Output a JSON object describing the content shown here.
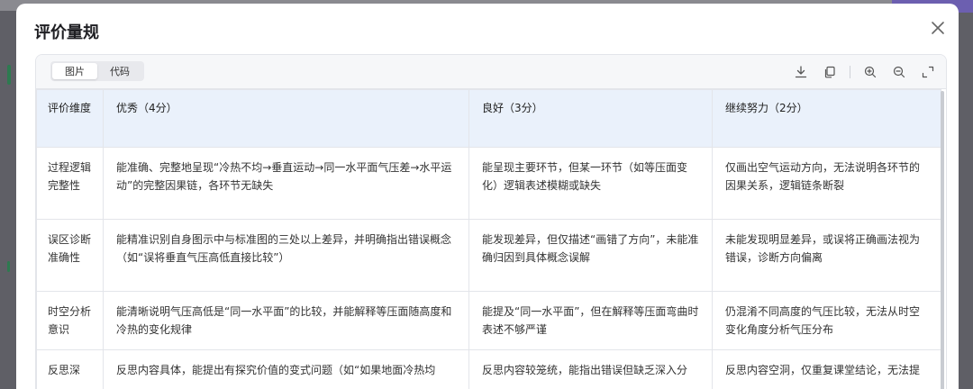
{
  "modal": {
    "title": "评价量规",
    "tabs": [
      {
        "label": "图片",
        "active": true
      },
      {
        "label": "代码",
        "active": false
      }
    ],
    "toolbar_icons": [
      "download-icon",
      "copy-icon",
      "zoom-in-icon",
      "zoom-out-icon",
      "fullscreen-icon"
    ]
  },
  "rubric": {
    "headers": [
      "评价维度",
      "优秀（4分）",
      "良好（3分）",
      "继续努力（2分）"
    ],
    "rows": [
      {
        "dimension": "过程逻辑完整性",
        "excellent": "能准确、完整地呈现“冷热不均→垂直运动→同一水平面气压差→水平运动”的完整因果链，各环节无缺失",
        "good": "能呈现主要环节，但某一环节（如等压面变化）逻辑表述模糊或缺失",
        "keep_trying": "仅画出空气运动方向，无法说明各环节的因果关系，逻辑链条断裂"
      },
      {
        "dimension": "误区诊断准确性",
        "excellent": "能精准识别自身图示中与标准图的三处以上差异，并明确指出错误概念（如“误将垂直气压高低直接比较”）",
        "good": "能发现差异，但仅描述“画错了方向”，未能准确归因到具体概念误解",
        "keep_trying": "未能发现明显差异，或误将正确画法视为错误，诊断方向偏离"
      },
      {
        "dimension": "时空分析意识",
        "excellent": "能清晰说明气压高低是“同一水平面”的比较，并能解释等压面随高度和冷热的变化规律",
        "good": "能提及“同一水平面”，但在解释等压面弯曲时表述不够严谨",
        "keep_trying": "仍混淆不同高度的气压比较，无法从时空变化角度分析气压分布"
      },
      {
        "dimension": "反思深",
        "excellent": "反思内容具体，能提出有探究价值的变式问题（如“如果地面冷热均",
        "good": "反思内容较笼统，能指出错误但缺乏深入分",
        "keep_trying": "反思内容空洞，仅重复课堂结论，无法提"
      }
    ]
  },
  "colors": {
    "header_bg": "#eaf1fb",
    "border": "#e3e5ea",
    "overlay": "#5f5f66",
    "toolbar_bg": "#f6f7f9"
  }
}
